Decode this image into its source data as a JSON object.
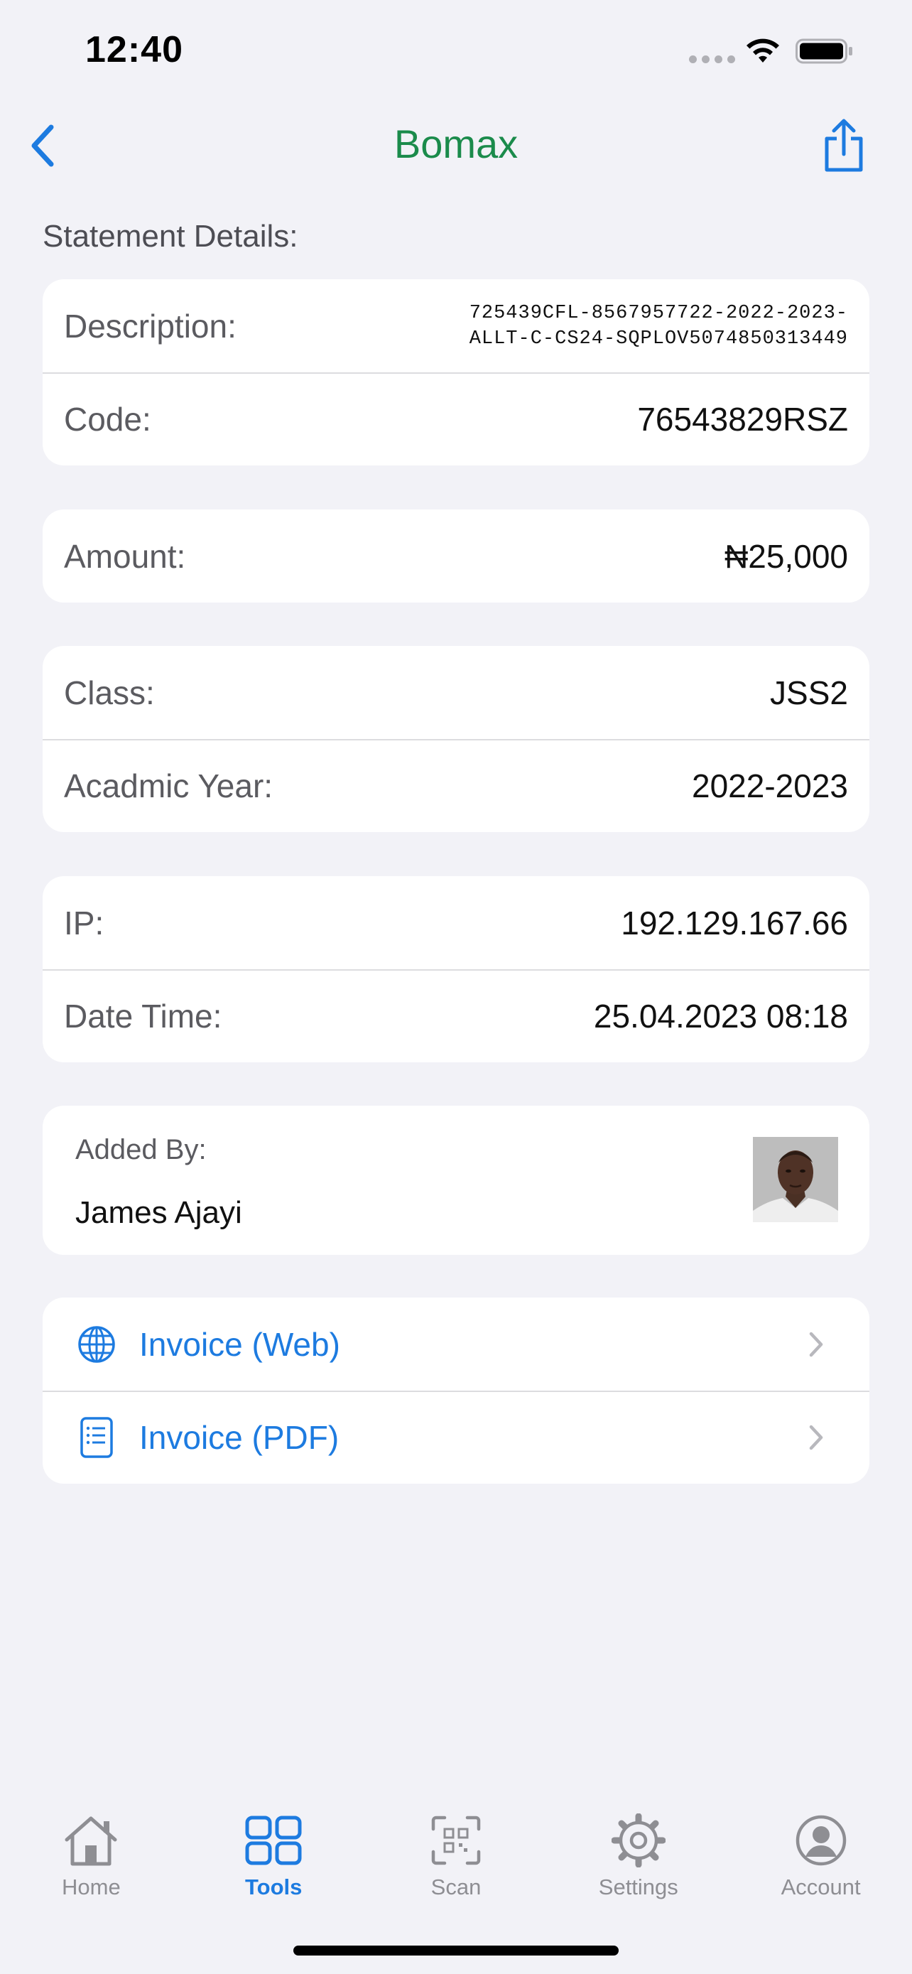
{
  "status_bar": {
    "time": "12:40"
  },
  "nav": {
    "title": "Bomax",
    "title_color": "#1b8b4b",
    "back_icon": "chevron-left-icon",
    "share_icon": "share-icon"
  },
  "section_label": "Statement Details:",
  "statement": {
    "description_label": "Description:",
    "description_line1": "725439CFL-8567957722-2022-2023-",
    "description_line2": "ALLT-C-CS24-SQPLOV5074850313449",
    "code_label": "Code:",
    "code_value": "76543829RSZ"
  },
  "amount": {
    "label": "Amount:",
    "value": "₦25,000"
  },
  "class_info": {
    "class_label": "Class:",
    "class_value": "JSS2",
    "year_label": "Acadmic Year:",
    "year_value": "2022-2023"
  },
  "meta": {
    "ip_label": "IP:",
    "ip_value": "192.129.167.66",
    "datetime_label": "Date Time:",
    "datetime_value": "25.04.2023 08:18"
  },
  "added_by": {
    "label": "Added By:",
    "name": "James Ajayi"
  },
  "links": [
    {
      "label": "Invoice (Web)",
      "icon": "globe-icon"
    },
    {
      "label": "Invoice (PDF)",
      "icon": "document-icon"
    }
  ],
  "tabs": [
    {
      "label": "Home",
      "icon": "home-icon",
      "active": false
    },
    {
      "label": "Tools",
      "icon": "grid-icon",
      "active": true
    },
    {
      "label": "Scan",
      "icon": "qr-scan-icon",
      "active": false
    },
    {
      "label": "Settings",
      "icon": "gear-icon",
      "active": false
    },
    {
      "label": "Account",
      "icon": "person-circle-icon",
      "active": false
    }
  ],
  "colors": {
    "accent": "#1d7be0",
    "background": "#f2f2f7",
    "tab_inactive": "#8e8e93"
  }
}
